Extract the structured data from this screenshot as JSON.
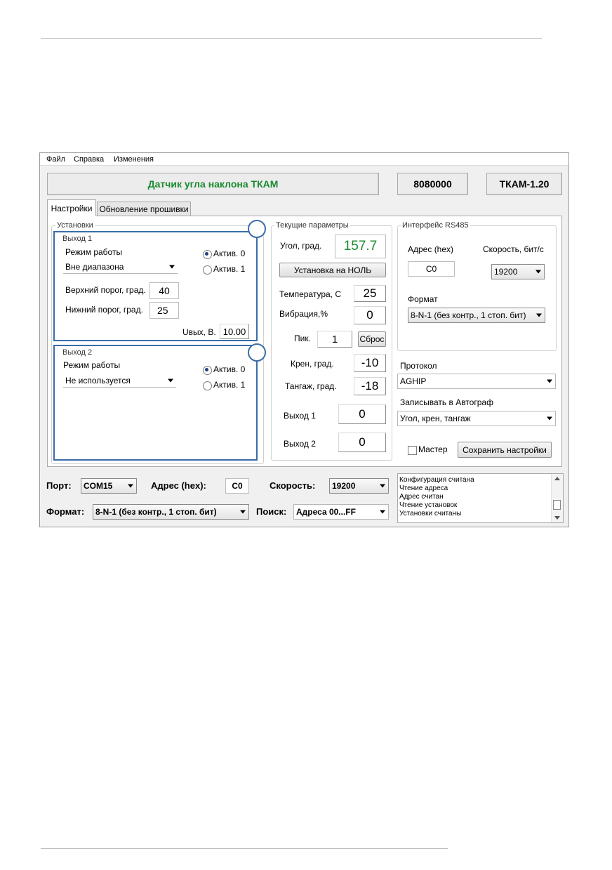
{
  "menu": [
    "Файл",
    "Справка",
    "Изменения"
  ],
  "header": {
    "title": "Датчик угла наклона ТКАМ",
    "serial": "8080000",
    "version": "ТКАМ-1.20",
    "title_color": "#1a8a2e"
  },
  "tabs": [
    "Настройки",
    "Обновление прошивки"
  ],
  "settings": {
    "group_title": "Установки",
    "out1": {
      "title": "Выход 1",
      "mode_label": "Режим работы",
      "mode_value": "Вне диапазона",
      "radio1": "Актив. 0",
      "radio2": "Актив. 1",
      "upper_label": "Верхний порог, град.",
      "upper_value": "40",
      "lower_label": "Нижний порог, град.",
      "lower_value": "25",
      "uout_label": "Uвых, В.",
      "uout_value": "10.00"
    },
    "out2": {
      "title": "Выход 2",
      "mode_label": "Режим работы",
      "mode_value": "Не используется",
      "radio1": "Актив. 0",
      "radio2": "Актив. 1"
    }
  },
  "current": {
    "title": "Текущие параметры",
    "angle_label": "Угол, град.",
    "angle_value": "157.7",
    "angle_color": "#1a8a2e",
    "zero_button": "Установка на НОЛЬ",
    "temp_label": "Температура, С",
    "temp_value": "25",
    "vib_label": "Вибрация,%",
    "vib_value": "0",
    "peak_label": "Пик.",
    "peak_value": "1",
    "reset_button": "Сброс",
    "roll_label": "Крен, град.",
    "roll_value": "-10",
    "pitch_label": "Тангаж, град.",
    "pitch_value": "-18",
    "out1_label": "Выход 1",
    "out1_value": "0",
    "out2_label": "Выход 2",
    "out2_value": "0"
  },
  "rs485": {
    "title": "Интерфейс RS485",
    "addr_label": "Адрес (hex)",
    "addr_value": "C0",
    "speed_label": "Скорость, бит/с",
    "speed_value": "19200",
    "format_label": "Формат",
    "format_value": "8-N-1 (без контр., 1 стоп. бит)"
  },
  "protocol": {
    "label": "Протокол",
    "value": "AGHIP"
  },
  "autograph": {
    "label": "Записывать в Автограф",
    "value": "Угол, крен, тангаж"
  },
  "master_label": "Мастер",
  "save_button": "Сохранить настройки",
  "bottom": {
    "port_label": "Порт:",
    "port_value": "COM15",
    "addr_label": "Адрес (hex):",
    "addr_value": "C0",
    "speed_label": "Скорость:",
    "speed_value": "19200",
    "format_label": "Формат:",
    "format_value": "8-N-1 (без контр., 1 стоп. бит)",
    "search_label": "Поиск:",
    "search_value": "Адреса 00...FF"
  },
  "log": [
    "Конфигурация считана",
    "Чтение адреса",
    "Адрес считан",
    "Чтение установок",
    "Установки считаны"
  ]
}
